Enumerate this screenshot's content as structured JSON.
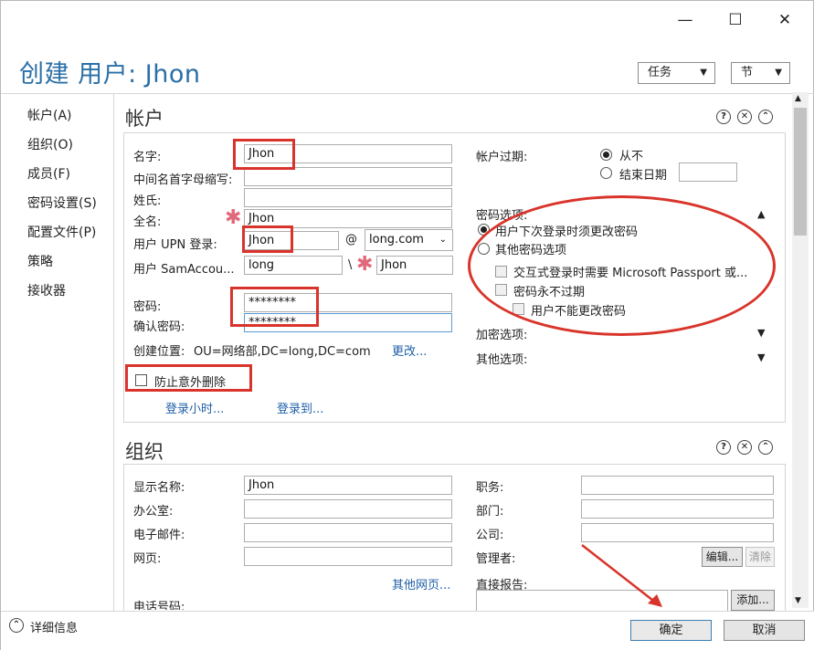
{
  "window": {
    "title": "创建 用户: Jhon",
    "controls": {
      "minimize": "—",
      "maximize": "☐",
      "close": "✕"
    }
  },
  "header": {
    "tasks_label": "任务",
    "sections_label": "节"
  },
  "nav": {
    "items": [
      "帐户(A)",
      "组织(O)",
      "成员(F)",
      "密码设置(S)",
      "配置文件(P)",
      "策略",
      "接收器"
    ]
  },
  "account": {
    "section_title": "帐户",
    "first_name_label": "名字:",
    "first_name_value": "Jhon",
    "middle_initial_label": "中间名首字母缩写:",
    "middle_initial_value": "",
    "last_name_label": "姓氏:",
    "last_name_value": "",
    "full_name_label": "全名:",
    "full_name_value": "Jhon",
    "upn_label": "用户 UPN 登录:",
    "upn_value": "Jhon",
    "at_sign": "@",
    "domain_value": "long.com",
    "sam_label": "用户 SamAccou...",
    "sam_domain_value": "long",
    "backslash": "\\",
    "sam_user_value": "Jhon",
    "password_label": "密码:",
    "password_value": "********",
    "confirm_password_label": "确认密码:",
    "confirm_password_value": "********",
    "create_in_label": "创建位置:",
    "create_in_value": "OU=网络部,DC=long,DC=com",
    "change_link": "更改...",
    "protect_label": "防止意外删除",
    "logon_hours_link": "登录小时...",
    "logon_to_link": "登录到...",
    "expire_label": "帐户过期:",
    "never_label": "从不",
    "end_date_label": "结束日期",
    "end_date_value": "",
    "password_options_label": "密码选项:",
    "opt_change_next_logon": "用户下次登录时须更改密码",
    "opt_other": "其他密码选项",
    "opt_passport": "交互式登录时需要 Microsoft Passport 或...",
    "opt_never_expire": "密码永不过期",
    "opt_cannot_change": "用户不能更改密码",
    "encryption_options_label": "加密选项:",
    "other_options_label": "其他选项:"
  },
  "organization": {
    "section_title": "组织",
    "display_name_label": "显示名称:",
    "display_name_value": "Jhon",
    "office_label": "办公室:",
    "office_value": "",
    "email_label": "电子邮件:",
    "email_value": "",
    "webpage_label": "网页:",
    "webpage_value": "",
    "other_webpages_link": "其他网页...",
    "phone_label": "电话号码:",
    "job_title_label": "职务:",
    "job_title_value": "",
    "department_label": "部门:",
    "department_value": "",
    "company_label": "公司:",
    "company_value": "",
    "manager_label": "管理者:",
    "edit_button": "编辑...",
    "clear_button": "清除",
    "direct_reports_label": "直接报告:",
    "add_button": "添加..."
  },
  "footer": {
    "more_info_label": "详细信息",
    "ok_button": "确定",
    "cancel_button": "取消"
  },
  "colors": {
    "accent": "#2a6fa6",
    "link": "#1f5fa8",
    "annotation": "#d9342b",
    "required_star": "#e06a7a"
  }
}
